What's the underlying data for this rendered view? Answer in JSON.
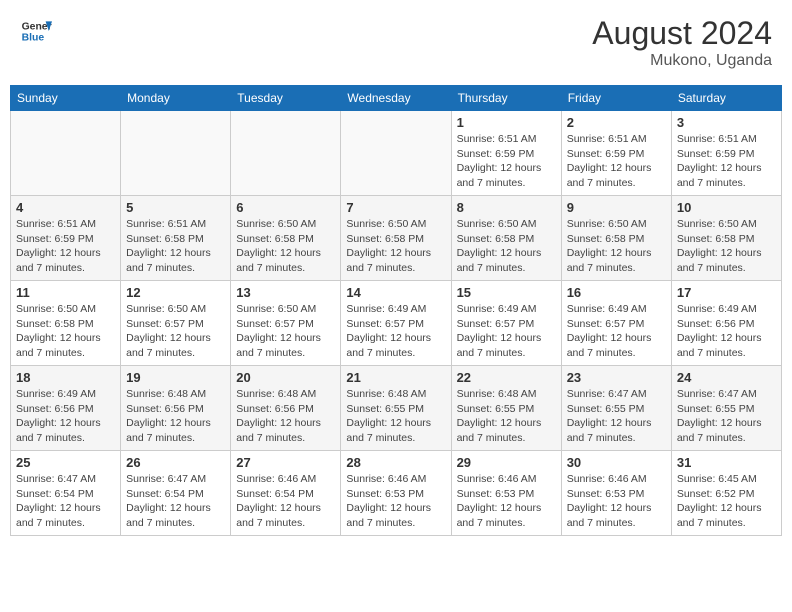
{
  "header": {
    "logo_general": "General",
    "logo_blue": "Blue",
    "month_year": "August 2024",
    "location": "Mukono, Uganda"
  },
  "days_of_week": [
    "Sunday",
    "Monday",
    "Tuesday",
    "Wednesday",
    "Thursday",
    "Friday",
    "Saturday"
  ],
  "weeks": [
    [
      {
        "day": "",
        "sunrise": "",
        "sunset": "",
        "daylight": ""
      },
      {
        "day": "",
        "sunrise": "",
        "sunset": "",
        "daylight": ""
      },
      {
        "day": "",
        "sunrise": "",
        "sunset": "",
        "daylight": ""
      },
      {
        "day": "",
        "sunrise": "",
        "sunset": "",
        "daylight": ""
      },
      {
        "day": "1",
        "sunrise": "Sunrise: 6:51 AM",
        "sunset": "Sunset: 6:59 PM",
        "daylight": "Daylight: 12 hours and 7 minutes."
      },
      {
        "day": "2",
        "sunrise": "Sunrise: 6:51 AM",
        "sunset": "Sunset: 6:59 PM",
        "daylight": "Daylight: 12 hours and 7 minutes."
      },
      {
        "day": "3",
        "sunrise": "Sunrise: 6:51 AM",
        "sunset": "Sunset: 6:59 PM",
        "daylight": "Daylight: 12 hours and 7 minutes."
      }
    ],
    [
      {
        "day": "4",
        "sunrise": "Sunrise: 6:51 AM",
        "sunset": "Sunset: 6:59 PM",
        "daylight": "Daylight: 12 hours and 7 minutes."
      },
      {
        "day": "5",
        "sunrise": "Sunrise: 6:51 AM",
        "sunset": "Sunset: 6:58 PM",
        "daylight": "Daylight: 12 hours and 7 minutes."
      },
      {
        "day": "6",
        "sunrise": "Sunrise: 6:50 AM",
        "sunset": "Sunset: 6:58 PM",
        "daylight": "Daylight: 12 hours and 7 minutes."
      },
      {
        "day": "7",
        "sunrise": "Sunrise: 6:50 AM",
        "sunset": "Sunset: 6:58 PM",
        "daylight": "Daylight: 12 hours and 7 minutes."
      },
      {
        "day": "8",
        "sunrise": "Sunrise: 6:50 AM",
        "sunset": "Sunset: 6:58 PM",
        "daylight": "Daylight: 12 hours and 7 minutes."
      },
      {
        "day": "9",
        "sunrise": "Sunrise: 6:50 AM",
        "sunset": "Sunset: 6:58 PM",
        "daylight": "Daylight: 12 hours and 7 minutes."
      },
      {
        "day": "10",
        "sunrise": "Sunrise: 6:50 AM",
        "sunset": "Sunset: 6:58 PM",
        "daylight": "Daylight: 12 hours and 7 minutes."
      }
    ],
    [
      {
        "day": "11",
        "sunrise": "Sunrise: 6:50 AM",
        "sunset": "Sunset: 6:58 PM",
        "daylight": "Daylight: 12 hours and 7 minutes."
      },
      {
        "day": "12",
        "sunrise": "Sunrise: 6:50 AM",
        "sunset": "Sunset: 6:57 PM",
        "daylight": "Daylight: 12 hours and 7 minutes."
      },
      {
        "day": "13",
        "sunrise": "Sunrise: 6:50 AM",
        "sunset": "Sunset: 6:57 PM",
        "daylight": "Daylight: 12 hours and 7 minutes."
      },
      {
        "day": "14",
        "sunrise": "Sunrise: 6:49 AM",
        "sunset": "Sunset: 6:57 PM",
        "daylight": "Daylight: 12 hours and 7 minutes."
      },
      {
        "day": "15",
        "sunrise": "Sunrise: 6:49 AM",
        "sunset": "Sunset: 6:57 PM",
        "daylight": "Daylight: 12 hours and 7 minutes."
      },
      {
        "day": "16",
        "sunrise": "Sunrise: 6:49 AM",
        "sunset": "Sunset: 6:57 PM",
        "daylight": "Daylight: 12 hours and 7 minutes."
      },
      {
        "day": "17",
        "sunrise": "Sunrise: 6:49 AM",
        "sunset": "Sunset: 6:56 PM",
        "daylight": "Daylight: 12 hours and 7 minutes."
      }
    ],
    [
      {
        "day": "18",
        "sunrise": "Sunrise: 6:49 AM",
        "sunset": "Sunset: 6:56 PM",
        "daylight": "Daylight: 12 hours and 7 minutes."
      },
      {
        "day": "19",
        "sunrise": "Sunrise: 6:48 AM",
        "sunset": "Sunset: 6:56 PM",
        "daylight": "Daylight: 12 hours and 7 minutes."
      },
      {
        "day": "20",
        "sunrise": "Sunrise: 6:48 AM",
        "sunset": "Sunset: 6:56 PM",
        "daylight": "Daylight: 12 hours and 7 minutes."
      },
      {
        "day": "21",
        "sunrise": "Sunrise: 6:48 AM",
        "sunset": "Sunset: 6:55 PM",
        "daylight": "Daylight: 12 hours and 7 minutes."
      },
      {
        "day": "22",
        "sunrise": "Sunrise: 6:48 AM",
        "sunset": "Sunset: 6:55 PM",
        "daylight": "Daylight: 12 hours and 7 minutes."
      },
      {
        "day": "23",
        "sunrise": "Sunrise: 6:47 AM",
        "sunset": "Sunset: 6:55 PM",
        "daylight": "Daylight: 12 hours and 7 minutes."
      },
      {
        "day": "24",
        "sunrise": "Sunrise: 6:47 AM",
        "sunset": "Sunset: 6:55 PM",
        "daylight": "Daylight: 12 hours and 7 minutes."
      }
    ],
    [
      {
        "day": "25",
        "sunrise": "Sunrise: 6:47 AM",
        "sunset": "Sunset: 6:54 PM",
        "daylight": "Daylight: 12 hours and 7 minutes."
      },
      {
        "day": "26",
        "sunrise": "Sunrise: 6:47 AM",
        "sunset": "Sunset: 6:54 PM",
        "daylight": "Daylight: 12 hours and 7 minutes."
      },
      {
        "day": "27",
        "sunrise": "Sunrise: 6:46 AM",
        "sunset": "Sunset: 6:54 PM",
        "daylight": "Daylight: 12 hours and 7 minutes."
      },
      {
        "day": "28",
        "sunrise": "Sunrise: 6:46 AM",
        "sunset": "Sunset: 6:53 PM",
        "daylight": "Daylight: 12 hours and 7 minutes."
      },
      {
        "day": "29",
        "sunrise": "Sunrise: 6:46 AM",
        "sunset": "Sunset: 6:53 PM",
        "daylight": "Daylight: 12 hours and 7 minutes."
      },
      {
        "day": "30",
        "sunrise": "Sunrise: 6:46 AM",
        "sunset": "Sunset: 6:53 PM",
        "daylight": "Daylight: 12 hours and 7 minutes."
      },
      {
        "day": "31",
        "sunrise": "Sunrise: 6:45 AM",
        "sunset": "Sunset: 6:52 PM",
        "daylight": "Daylight: 12 hours and 7 minutes."
      }
    ]
  ]
}
